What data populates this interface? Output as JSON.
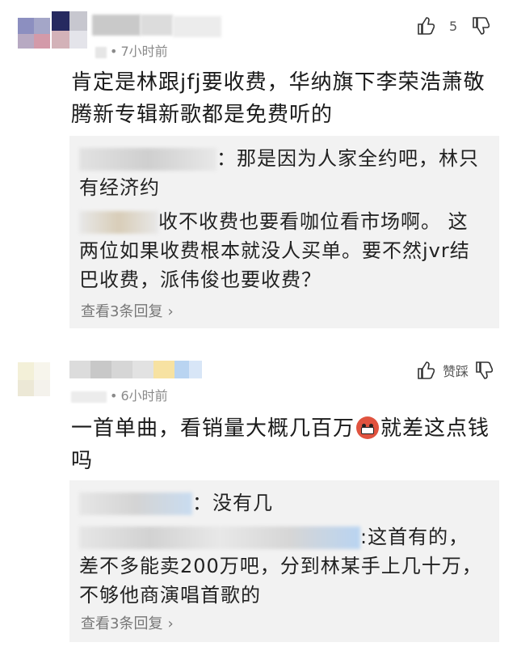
{
  "comments": [
    {
      "time": "7小时前",
      "likes": "5",
      "text": "肯定是林跟jfj要收费，华纳旗下李荣浩萧敬腾新专辑新歌都是免费听的",
      "replies": [
        {
          "text": "：那是因为人家全约吧，林只有经济约"
        },
        {
          "text": "收不收费也要看咖位看市场啊。 这两位如果收费根本就没人买单。要不然jvr结巴收费，派伟俊也要收费？"
        }
      ],
      "view_more": "查看3条回复"
    },
    {
      "time": "6小时前",
      "likes": "赞踩",
      "text_part1": "一首单曲，看销量大概几百万",
      "text_part2": "就差这点钱吗",
      "replies": [
        {
          "text": "：没有几"
        },
        {
          "text": ":这首有的，差不多能卖200万吧，分到林某手上几十万，不够他商演唱首歌的"
        }
      ],
      "view_more": "查看3条回复"
    }
  ],
  "colors": {
    "meta": "#8a8a8a",
    "reply_bg": "#f2f2f2",
    "emoji": "#e0533f"
  }
}
